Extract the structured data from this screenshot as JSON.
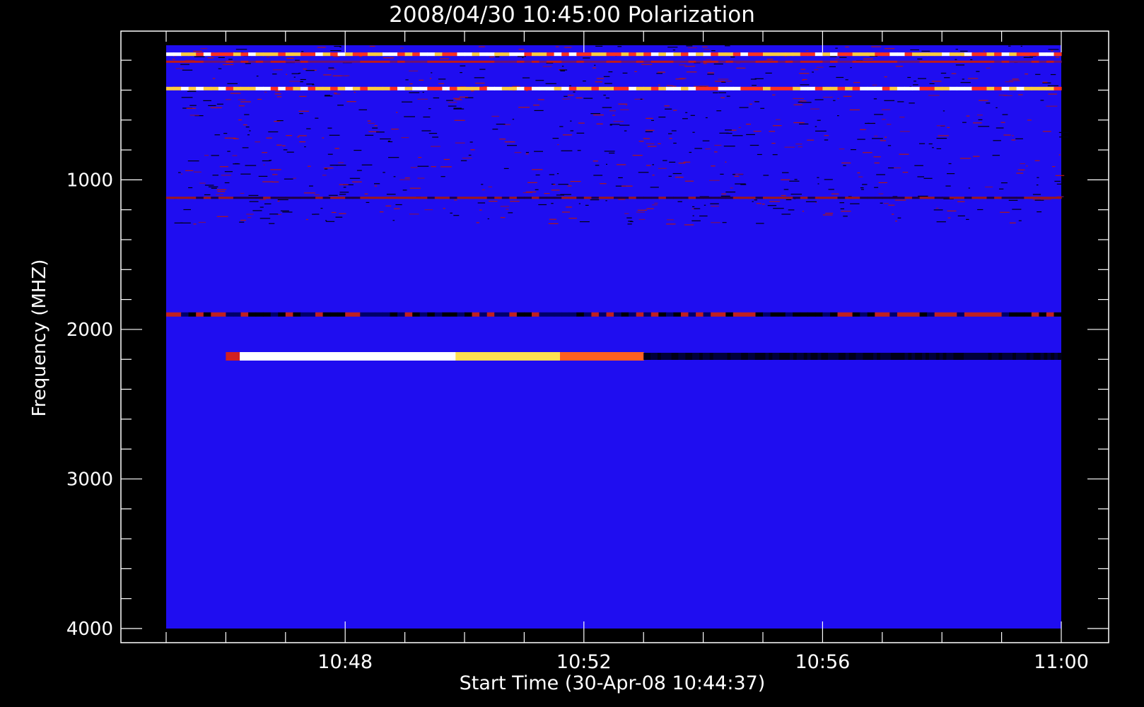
{
  "chart_data": {
    "type": "heatmap",
    "title": "2008/04/30 10:45:00 Polarization",
    "xlabel": "Start Time (30-Apr-08 10:44:37)",
    "ylabel": "Frequency (MHZ)",
    "x_range": [
      "10:45:00",
      "11:00:00"
    ],
    "y_range": [
      100,
      4000
    ],
    "y_ticks": [
      1000,
      2000,
      3000,
      4000
    ],
    "x_ticks": [
      "10:48",
      "10:52",
      "10:56",
      "11:00"
    ],
    "colormap": [
      "#000000",
      "#1a0aff",
      "#c81e1e",
      "#ff8000",
      "#ffff66",
      "#ffffff"
    ],
    "background_color": "#1f0df0",
    "features": [
      {
        "freq_mhz": 160,
        "start": "10:45:00",
        "end": "11:00:00",
        "intensity": "high"
      },
      {
        "freq_mhz": 210,
        "start": "10:45:00",
        "end": "11:00:00",
        "intensity": "medium"
      },
      {
        "freq_mhz": 390,
        "start": "10:45:00",
        "end": "11:00:00",
        "intensity": "high"
      },
      {
        "freq_mhz": 1120,
        "start": "10:45:00",
        "end": "11:00:00",
        "intensity": "low"
      },
      {
        "freq_mhz": 1900,
        "start": "10:45:00",
        "end": "11:00:00",
        "intensity": "mixed"
      },
      {
        "freq_mhz": 2180,
        "start": "10:46:00",
        "end": "10:53:00",
        "intensity": "burst"
      },
      {
        "freq_mhz": 2180,
        "start": "10:53:00",
        "end": "11:00:00",
        "intensity": "dark"
      }
    ]
  }
}
